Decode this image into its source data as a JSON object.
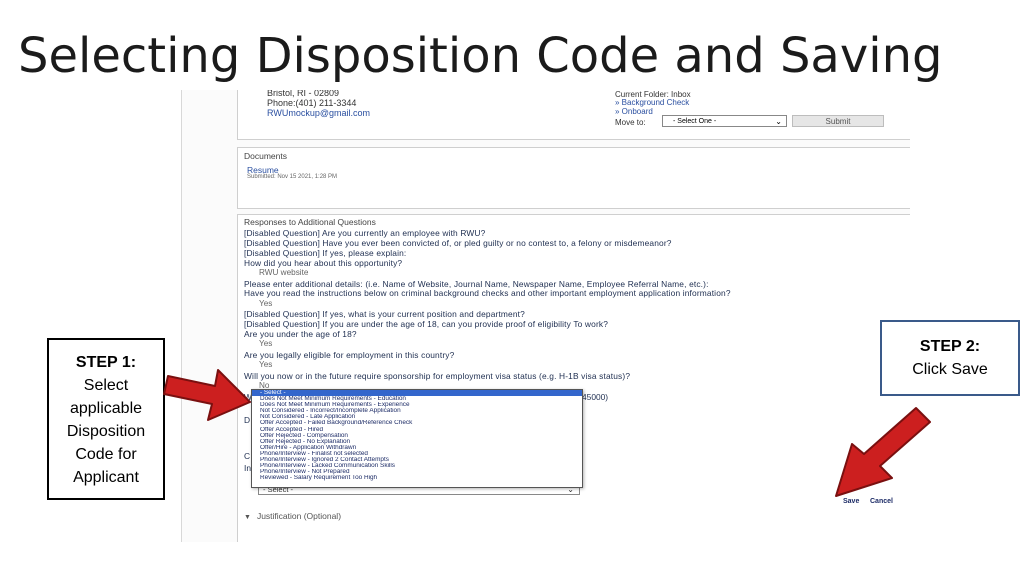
{
  "slide": {
    "title": "Selecting Disposition Code and Saving"
  },
  "contact": {
    "address": "Bristol, RI - 02809",
    "phone": "Phone:(401) 211-3344",
    "email": "RWUmockup@gmail.com"
  },
  "folder": {
    "current": "Current Folder: Inbox",
    "items": [
      "» Background Check",
      "» Onboard"
    ],
    "move_to_label": "Move to:",
    "move_to_value": "- Select One -",
    "submit_label": "Submit"
  },
  "documents": {
    "header": "Documents",
    "resume_label": "Resume",
    "resume_date": "Submitted: Nov 15 2021, 1:28 PM"
  },
  "responses": {
    "header": "Responses to Additional Questions",
    "lines": [
      {
        "kind": "q",
        "text": "[Disabled Question] Are you currently an employee with RWU?"
      },
      {
        "kind": "q",
        "text": "[Disabled Question] Have you ever been convicted of, or pled guilty or no contest to, a felony or misdemeanor?"
      },
      {
        "kind": "q",
        "text": "[Disabled Question] If yes, please explain:"
      },
      {
        "kind": "q",
        "text": "How did you hear about this opportunity?"
      },
      {
        "kind": "a",
        "text": "RWU website"
      },
      {
        "kind": "q",
        "text": "Please enter additional details: (i.e. Name of Website, Journal Name, Newspaper Name, Employee Referral Name, etc.):"
      },
      {
        "kind": "q",
        "text": "Have you read the instructions below on criminal background checks and other important employment application information?"
      },
      {
        "kind": "a",
        "text": "Yes"
      },
      {
        "kind": "q",
        "text": "[Disabled Question] If yes, what is your current position and department?"
      },
      {
        "kind": "q",
        "text": "[Disabled Question] If you are under the age of 18, can you provide proof of eligibility To work?"
      },
      {
        "kind": "q",
        "text": "Are you under the age of 18?"
      },
      {
        "kind": "a",
        "text": "Yes"
      },
      {
        "kind": "q",
        "text": "Are you legally eligible for employment in this country?"
      },
      {
        "kind": "a",
        "text": "Yes"
      },
      {
        "kind": "q",
        "text": "Will you now or in the future require sponsorship for employment visa status (e.g. H-1B visa status)?"
      },
      {
        "kind": "a",
        "text": "No"
      }
    ],
    "partial_w": "W",
    "partial_salary": "45000)",
    "partial_d": "D",
    "partial_c": "C",
    "partial_in": "In"
  },
  "disposition": {
    "options": [
      "- Select -",
      "Does Not Meet Minimum Requirements - Education",
      "Does Not Meet Minimum Requirements - Experience",
      "Not Considered - Incorrect/Incomplete Application",
      "Not Considered - Late Application",
      "Offer Accepted - Failed Background/Reference Check",
      "Offer Accepted - Hired",
      "Offer Rejected - Compensation",
      "Offer Rejected - No Explanation",
      "Offer/Hire - Application Withdrawn",
      "Phone/Interview - Finalist not selected",
      "Phone/Interview - Ignored 2 Contact Attempts",
      "Phone/Interview - Lacked Communication Skills",
      "Phone/Interview - Not Prepared",
      "Reviewed - Salary Requirement Too High"
    ],
    "selected_value": "- Select -",
    "save_label": "Save",
    "cancel_label": "Cancel",
    "justification_label": "Justification (Optional)"
  },
  "steps": {
    "step1": {
      "title": "STEP 1:",
      "lines": [
        "Select",
        "applicable",
        "Disposition",
        "Code for",
        "Applicant"
      ]
    },
    "step2": {
      "title": "STEP 2:",
      "lines": [
        "Click Save"
      ]
    }
  },
  "colors": {
    "arrow": "#cc1f1f",
    "arrow_outline": "#7a1010",
    "link": "#2a4fa0",
    "selected": "#3366cc"
  }
}
